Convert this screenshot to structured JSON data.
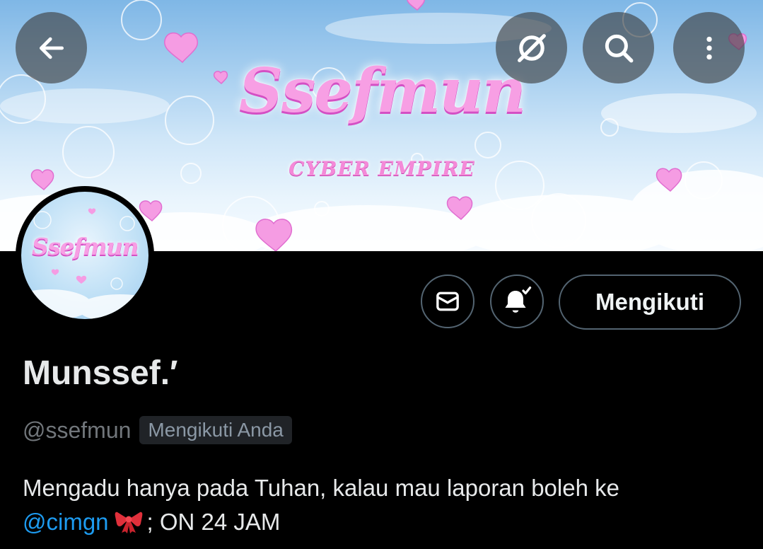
{
  "banner": {
    "title": "Ssefmun",
    "subtitle": "CYBER EMPIRE"
  },
  "top_bar": {
    "back_icon": "arrow-left-icon",
    "grok_icon": "slashed-circle-icon",
    "search_icon": "search-icon",
    "more_icon": "more-vertical-icon"
  },
  "avatar": {
    "logo_text": "Ssefmun"
  },
  "actions": {
    "message_icon": "envelope-icon",
    "notify_icon": "bell-check-icon",
    "follow_label": "Mengikuti"
  },
  "profile": {
    "display_name": "Munssef.′",
    "handle": "@ssefmun",
    "follows_you_badge": "Mengikuti Anda",
    "bio_text": "Mengadu hanya pada Tuhan, kalau mau laporan boleh ke",
    "bio_mention": "@cimgn",
    "bio_emoji_icon": "ribbon-icon",
    "bio_suffix": "; ON 24 JAM"
  },
  "colors": {
    "background": "#000000",
    "accent_link": "#1d9bf0",
    "secondary_text": "#71767b",
    "button_border": "#536471",
    "brand_pink": "#f79fe4"
  }
}
